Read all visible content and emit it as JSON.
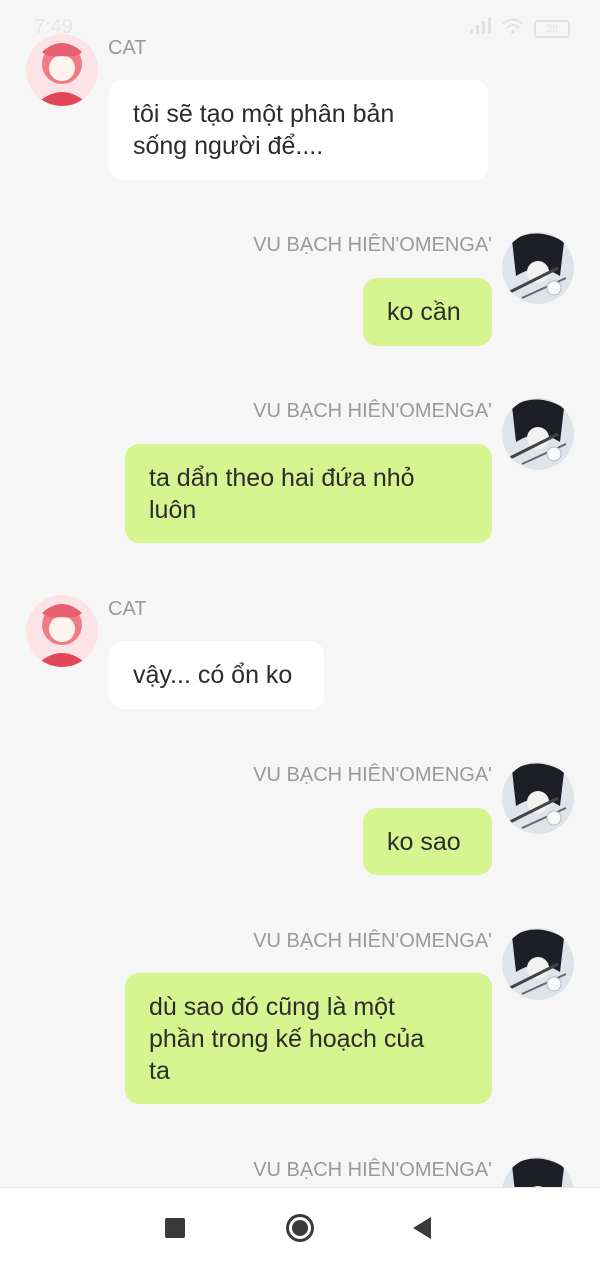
{
  "status_bar": {
    "time": "7:49",
    "battery": "38"
  },
  "chat": {
    "messages": [
      {
        "sender": "CAT",
        "side": "left",
        "text": "tôi sẽ tạo một phân bản\nsống người để...."
      },
      {
        "sender": "VU BẠCH HIÊN'OMENGA'",
        "side": "right",
        "text": "ko cần"
      },
      {
        "sender": "VU BẠCH HIÊN'OMENGA'",
        "side": "right",
        "text": "ta dẩn theo hai đứa nhỏ\nluôn"
      },
      {
        "sender": "CAT",
        "side": "left",
        "text": "vậy... có ổn ko"
      },
      {
        "sender": "VU BẠCH HIÊN'OMENGA'",
        "side": "right",
        "text": "ko sao"
      },
      {
        "sender": "VU BẠCH HIÊN'OMENGA'",
        "side": "right",
        "text": "dù sao đó cũng là một\nphần trong kế hoạch của\nta"
      },
      {
        "sender": "VU BẠCH HIÊN'OMENGA'",
        "side": "right",
        "text": ""
      }
    ]
  },
  "avatars": {
    "cat": "cat-avatar-icon",
    "vu": "vu-avatar-icon"
  },
  "colors": {
    "background": "#f6f6f6",
    "left_bubble": "#ffffff",
    "right_bubble": "#d6f590",
    "name": "#9a9a9a"
  },
  "nav_bar": {
    "icons": [
      "recent-apps-icon",
      "home-icon",
      "back-icon"
    ]
  }
}
